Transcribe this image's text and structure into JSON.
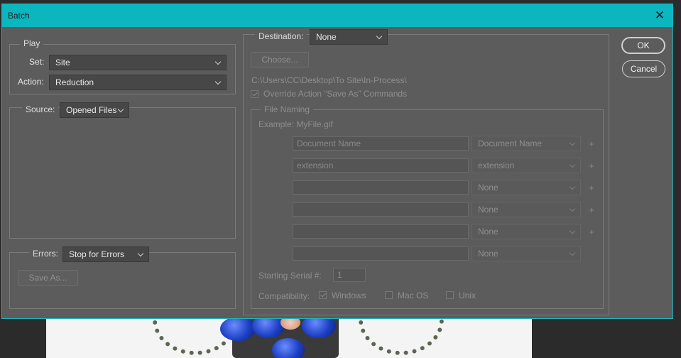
{
  "window": {
    "title": "Batch"
  },
  "buttons": {
    "ok": "OK",
    "cancel": "Cancel"
  },
  "play": {
    "legend": "Play",
    "set_label": "Set:",
    "set_value": "Site",
    "action_label": "Action:",
    "action_value": "Reduction"
  },
  "source": {
    "label": "Source:",
    "value": "Opened Files"
  },
  "errors": {
    "label": "Errors:",
    "value": "Stop for Errors",
    "save_as": "Save As..."
  },
  "destination": {
    "label": "Destination:",
    "value": "None",
    "choose": "Choose...",
    "path": "C:\\Users\\CC\\Desktop\\To Site\\In-Process\\",
    "override": "Override Action “Save As” Commands"
  },
  "file_naming": {
    "legend": "File Naming",
    "example_label": "Example: MyFile.gif",
    "rows": [
      {
        "text": "Document Name",
        "select": "Document Name",
        "plus": "+"
      },
      {
        "text": "extension",
        "select": "extension",
        "plus": "+"
      },
      {
        "text": "",
        "select": "None",
        "plus": "+"
      },
      {
        "text": "",
        "select": "None",
        "plus": "+"
      },
      {
        "text": "",
        "select": "None",
        "plus": "+"
      },
      {
        "text": "",
        "select": "None",
        "plus": ""
      }
    ],
    "serial_label": "Starting Serial #:",
    "serial_value": "1",
    "compat_label": "Compatibility:",
    "compat_options": [
      "Windows",
      "Mac OS",
      "Unix"
    ]
  }
}
